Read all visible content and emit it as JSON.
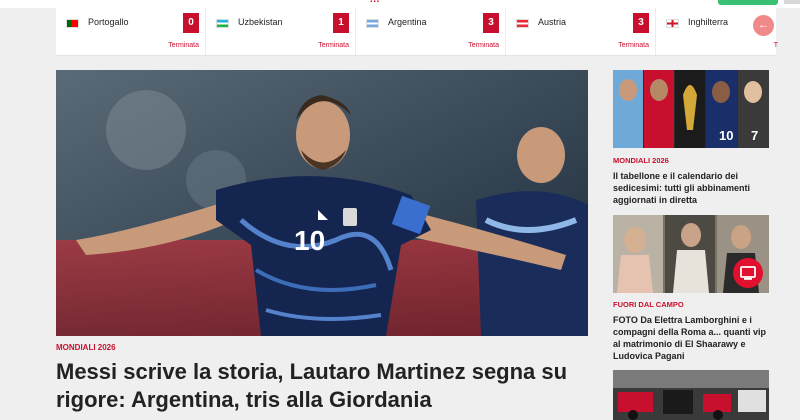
{
  "header": {
    "logo_fragment": "..."
  },
  "scores": [
    {
      "team": "Portogallo",
      "score": "0",
      "status": "Terminata",
      "flag_colors": [
        "#006600",
        "#ff0000"
      ]
    },
    {
      "team": "Uzbekistan",
      "score": "1",
      "status": "Terminata",
      "flag_colors": [
        "#1eb3e6",
        "#ffffff",
        "#1eb53a"
      ]
    },
    {
      "team": "Argentina",
      "score": "3",
      "status": "Terminata",
      "flag_colors": [
        "#75aadb",
        "#ffffff",
        "#75aadb"
      ]
    },
    {
      "team": "Austria",
      "score": "3",
      "status": "Terminata",
      "flag_colors": [
        "#ed2939",
        "#ffffff",
        "#ed2939"
      ]
    },
    {
      "team": "Inghilterra",
      "score": "",
      "status": "T",
      "flag_colors": [
        "#ffffff",
        "#cf142b"
      ]
    }
  ],
  "scroll_button_icon": "arrow-left-icon",
  "main_article": {
    "category": "MONDIALI 2026",
    "title": "Messi scrive la storia, Lautaro Martinez segna su rigore: Argentina, tris alla Giordania",
    "jersey_number": "10"
  },
  "side_articles": [
    {
      "category": "MONDIALI 2026",
      "title": "Il tabellone e il calendario dei sedicesimi: tutti gli abbinamenti aggiornati in diretta",
      "numbers": [
        "10",
        "7"
      ]
    },
    {
      "category": "FUORI DAL CAMPO",
      "title": "FOTO Da Elettra Lamborghini e i compagni della Roma a... quanti vip al matrimonio di El Shaarawy e Ludovica Pagani",
      "badge_icon": "video-icon"
    },
    {
      "category": "",
      "title": ""
    }
  ],
  "colors": {
    "accent": "#c8102e",
    "background": "#efefef"
  }
}
